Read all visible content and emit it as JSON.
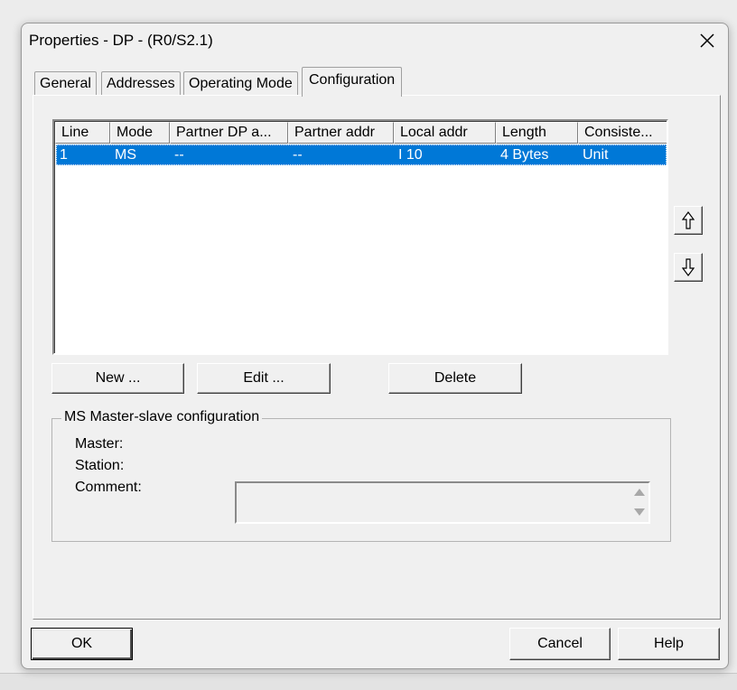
{
  "window": {
    "title": "Properties - DP - (R0/S2.1)"
  },
  "tabs": [
    {
      "label": "General"
    },
    {
      "label": "Addresses"
    },
    {
      "label": "Operating Mode"
    },
    {
      "label": "Configuration"
    }
  ],
  "active_tab": "Configuration",
  "table": {
    "columns": [
      "Line",
      "Mode",
      "Partner DP a...",
      "Partner addr",
      "Local addr",
      "Length",
      "Consiste..."
    ],
    "rows": [
      {
        "line": "1",
        "mode": "MS",
        "partner_dp": "--",
        "partner_addr": "--",
        "local_addr": "I 10",
        "length": "4 Bytes",
        "consistency": "Unit"
      }
    ]
  },
  "buttons": {
    "new": "New ...",
    "edit": "Edit ...",
    "delete": "Delete",
    "ok": "OK",
    "cancel": "Cancel",
    "help": "Help"
  },
  "group": {
    "title": "MS Master-slave configuration",
    "master_label": "Master:",
    "station_label": "Station:",
    "comment_label": "Comment:"
  },
  "icons": {
    "close": "close-icon",
    "move_up": "arrow-up-icon",
    "move_down": "arrow-down-icon"
  },
  "colors": {
    "selection": "#0078d7",
    "dialog_bg": "#f0f0f0"
  }
}
